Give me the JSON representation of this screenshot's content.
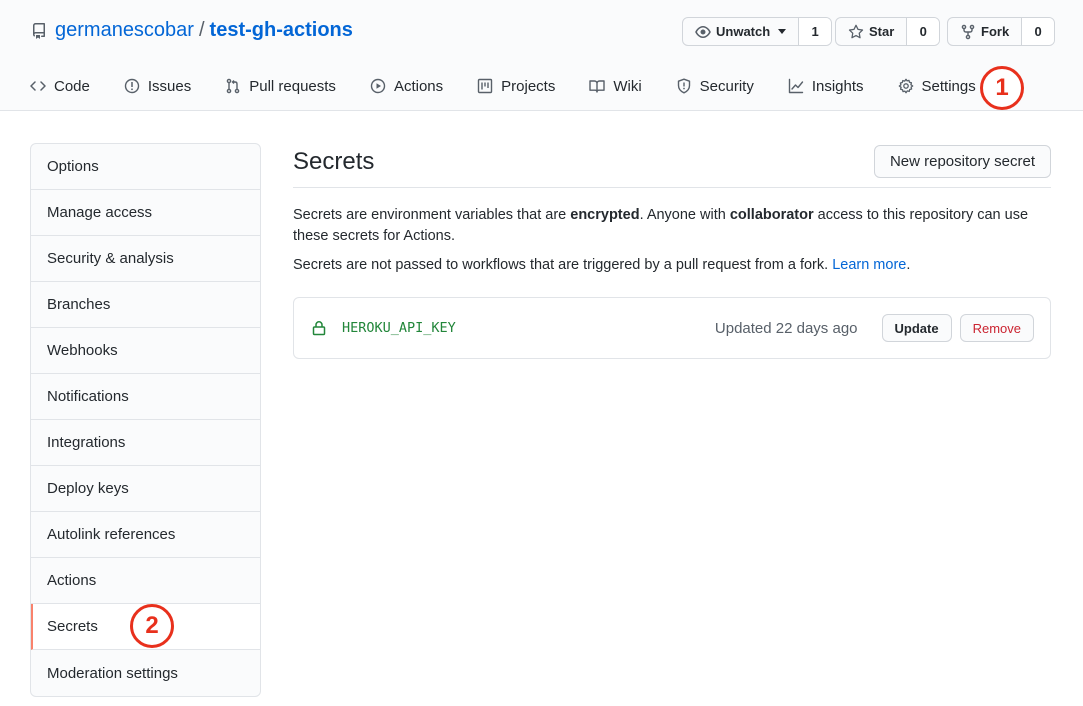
{
  "repo": {
    "owner": "germanescobar",
    "separator": "/",
    "name": "test-gh-actions"
  },
  "repo_actions": [
    {
      "label": "Unwatch",
      "count": "1",
      "icon": "eye-icon"
    },
    {
      "label": "Star",
      "count": "0",
      "icon": "star-icon"
    },
    {
      "label": "Fork",
      "count": "0",
      "icon": "fork-icon"
    }
  ],
  "tabs": [
    {
      "label": "Code",
      "icon": "code-icon"
    },
    {
      "label": "Issues",
      "icon": "issue-icon"
    },
    {
      "label": "Pull requests",
      "icon": "pull-request-icon"
    },
    {
      "label": "Actions",
      "icon": "play-icon"
    },
    {
      "label": "Projects",
      "icon": "project-icon"
    },
    {
      "label": "Wiki",
      "icon": "book-icon"
    },
    {
      "label": "Security",
      "icon": "shield-icon"
    },
    {
      "label": "Insights",
      "icon": "graph-icon"
    },
    {
      "label": "Settings",
      "icon": "gear-icon"
    }
  ],
  "annotations": {
    "one": "1",
    "two": "2"
  },
  "sidebar": {
    "items": [
      {
        "label": "Options"
      },
      {
        "label": "Manage access"
      },
      {
        "label": "Security & analysis"
      },
      {
        "label": "Branches"
      },
      {
        "label": "Webhooks"
      },
      {
        "label": "Notifications"
      },
      {
        "label": "Integrations"
      },
      {
        "label": "Deploy keys"
      },
      {
        "label": "Autolink references"
      },
      {
        "label": "Actions"
      },
      {
        "label": "Secrets",
        "selected": true
      },
      {
        "label": "Moderation settings"
      }
    ]
  },
  "main": {
    "title": "Secrets",
    "new_secret_label": "New repository secret",
    "desc": {
      "part1": "Secrets are environment variables that are ",
      "bold1": "encrypted",
      "part2": ". Anyone with ",
      "bold2": "collaborator",
      "part3": " access to this repository can use these secrets for Actions."
    },
    "desc2": {
      "text": "Secrets are not passed to workflows that are triggered by a pull request from a fork. ",
      "link": "Learn more",
      "end": "."
    },
    "secrets": [
      {
        "name": "HEROKU_API_KEY",
        "updated": "Updated 22 days ago",
        "update_label": "Update",
        "remove_label": "Remove"
      }
    ]
  },
  "colors": {
    "link": "#0366d6",
    "secret_name": "#22863a",
    "remove": "#cb2431",
    "annotation": "#e8301c",
    "selected_bar": "#f9826c"
  }
}
